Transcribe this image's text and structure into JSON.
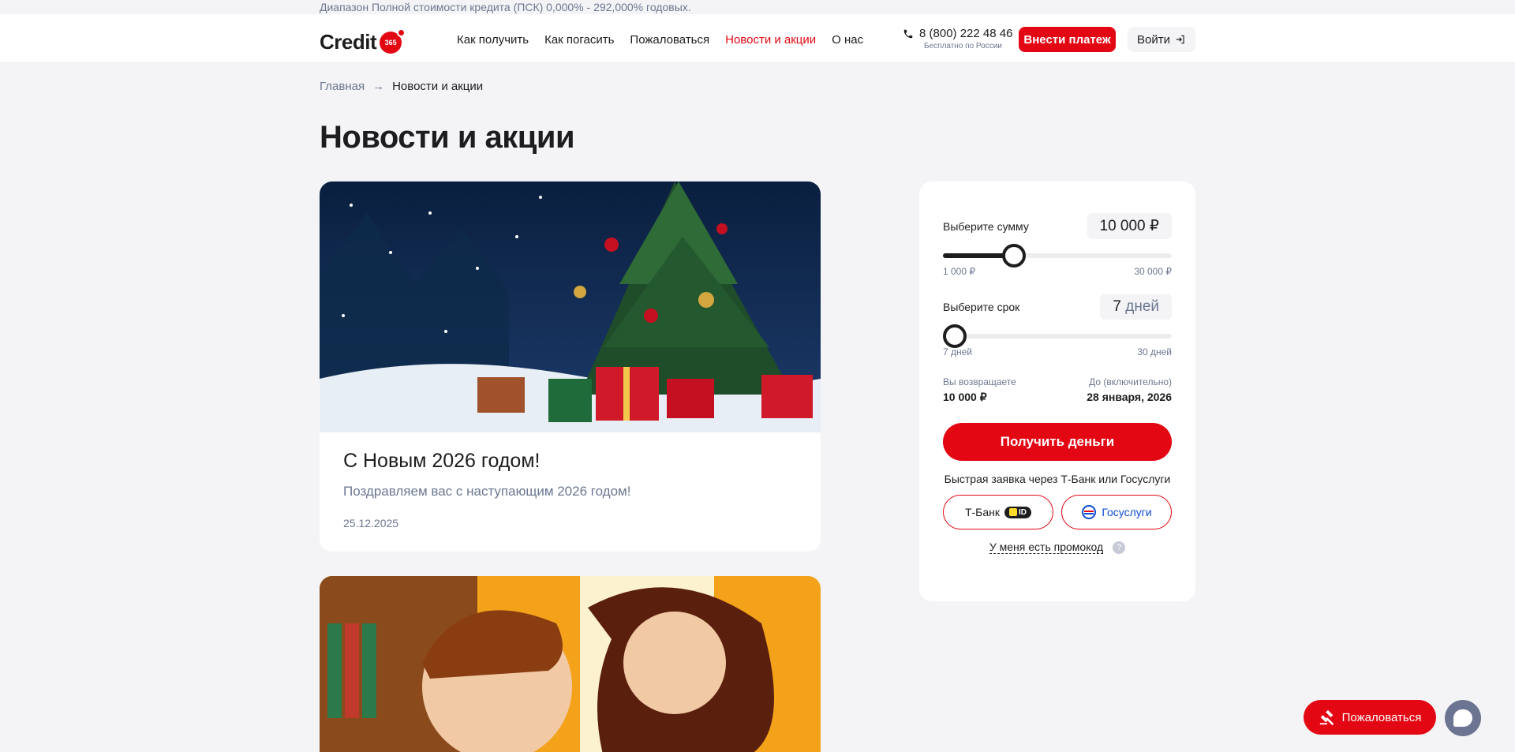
{
  "top_notice": "Диапазон Полной стоимости кредита (ПСК) 0,000% - 292,000% годовых.",
  "header": {
    "logo_text": "Credit",
    "logo_badge": "365",
    "nav": [
      "Как получить",
      "Как погасить",
      "Пожаловаться",
      "Новости и акции",
      "О нас"
    ],
    "active_nav": "Новости и акции",
    "phone": "8 (800) 222 48 46",
    "phone_sub": "Бесплатно по России",
    "pay_button": "Внести платеж",
    "login_button": "Войти"
  },
  "breadcrumb": {
    "home": "Главная",
    "arrow": "→",
    "current": "Новости и акции"
  },
  "page_title": "Новости и акции",
  "news": [
    {
      "title": "С Новым 2026 годом!",
      "description": "Поздравляем вас с наступающим 2026 годом!",
      "date": "25.12.2025"
    }
  ],
  "calculator": {
    "amount_label": "Выберите сумму",
    "amount_value": "10 000 ₽",
    "amount_min": "1 000 ₽",
    "amount_max": "30 000 ₽",
    "amount_fraction": 0.31,
    "term_label": "Выберите срок",
    "term_number": "7",
    "term_unit": "дней",
    "term_min": "7 дней",
    "term_max": "30 дней",
    "term_fraction": 0.0,
    "return_label": "Вы возвращаете",
    "return_value": "10 000 ₽",
    "until_label": "До (включительно)",
    "until_value": "28 января, 2026",
    "get_money_button": "Получить деньги",
    "fast_text": "Быстрая заявка через Т-Банк или Госуслуги",
    "tbank_button": "Т-Банк",
    "tbank_badge": "ID",
    "gos_button": "Госуслуги",
    "promo_link": "У меня есть промокод",
    "help_glyph": "?"
  },
  "floating": {
    "complain_button": "Пожаловаться"
  },
  "colors": {
    "brand_red": "#e30613",
    "muted": "#6b7790",
    "background": "#f4f4f6"
  }
}
